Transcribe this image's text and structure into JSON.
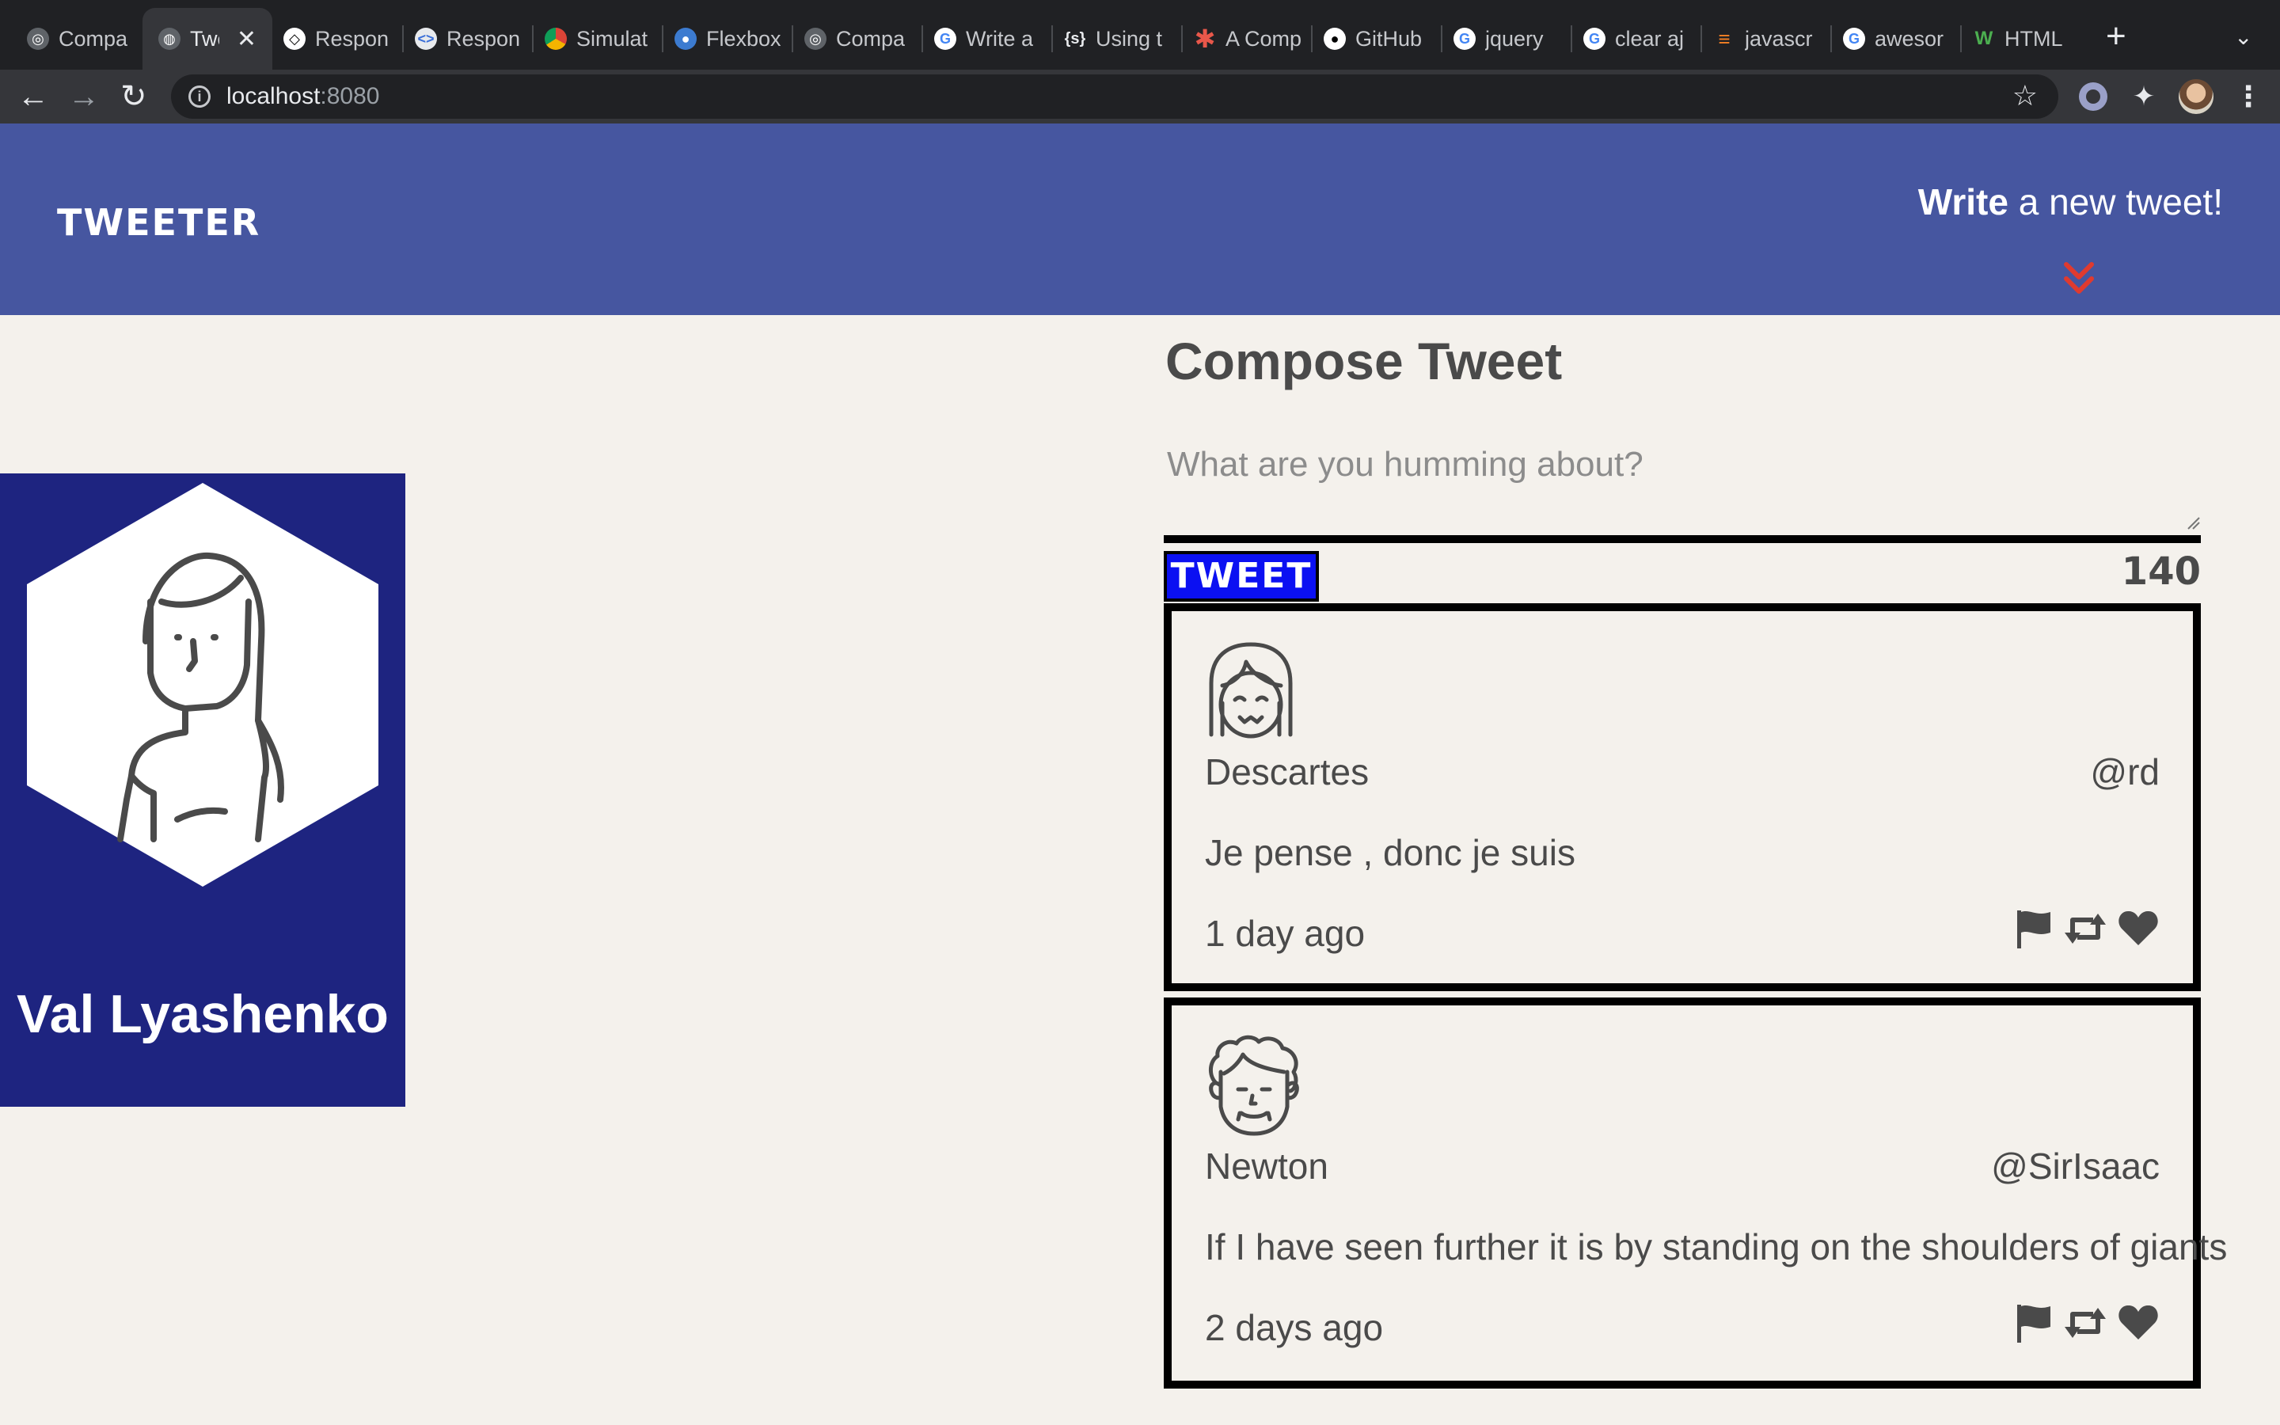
{
  "browser": {
    "tabs": [
      {
        "label": "Compa",
        "icon": "github-outline-icon"
      },
      {
        "label": "Twe",
        "icon": "globe-icon",
        "active": true
      },
      {
        "label": "Respon",
        "icon": "codepen-icon"
      },
      {
        "label": "Respon",
        "icon": "code-icon"
      },
      {
        "label": "Simulat",
        "icon": "chrome-icon"
      },
      {
        "label": "Flexbox",
        "icon": "droplet-icon"
      },
      {
        "label": "Compa",
        "icon": "github-outline-icon"
      },
      {
        "label": "Write a",
        "icon": "google-icon"
      },
      {
        "label": "Using t",
        "icon": "braces-icon"
      },
      {
        "label": "A Comp",
        "icon": "asterisk-icon"
      },
      {
        "label": "GitHub",
        "icon": "github-icon"
      },
      {
        "label": "jquery",
        "icon": "google-icon"
      },
      {
        "label": "clear aj",
        "icon": "google-icon"
      },
      {
        "label": "javascr",
        "icon": "stackoverflow-icon"
      },
      {
        "label": "awesor",
        "icon": "google-icon"
      },
      {
        "label": "HTML",
        "icon": "w3schools-icon"
      }
    ],
    "url_host": "localhost",
    "url_port": ":8080"
  },
  "nav": {
    "logo": "TWEETER",
    "write_bold": "Write",
    "write_rest": " a new tweet!"
  },
  "profile": {
    "name": "Val Lyashenko"
  },
  "compose": {
    "title": "Compose Tweet",
    "placeholder": "What are you humming about?",
    "button": "TWEET",
    "counter": "140"
  },
  "tweets": [
    {
      "name": "Descartes",
      "handle": "@rd",
      "text": "Je pense , donc je suis",
      "date": "1 day ago"
    },
    {
      "name": "Newton",
      "handle": "@SirIsaac",
      "text": "If I have seen further it is by standing on the shoulders of giants",
      "date": "2 days ago"
    }
  ],
  "colors": {
    "nav_bg": "#4656a0",
    "profile_bg": "#1e2480",
    "page_bg": "#f4f1ec",
    "tweet_button": "#0b10f2",
    "chevron": "#e03a2f"
  }
}
